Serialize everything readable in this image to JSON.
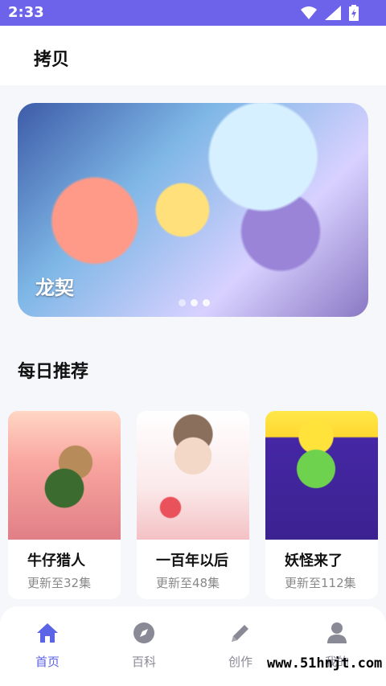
{
  "status": {
    "time": "2:33",
    "icons": [
      "wifi-icon",
      "signal-icon",
      "battery-icon"
    ]
  },
  "header": {
    "title": "拷贝"
  },
  "banner": {
    "title": "龙契",
    "slides_total": 3,
    "active_slide": 2
  },
  "daily": {
    "title": "每日推荐",
    "cards": [
      {
        "title": "牛仔猎人",
        "subtitle": "更新至32集"
      },
      {
        "title": "一百年以后",
        "subtitle": "更新至48集"
      },
      {
        "title": "妖怪来了",
        "subtitle": "更新至112集"
      }
    ]
  },
  "bottom_nav": {
    "items": [
      {
        "label": "首页",
        "icon": "home-icon",
        "active": true
      },
      {
        "label": "百科",
        "icon": "compass-icon",
        "active": false
      },
      {
        "label": "创作",
        "icon": "pencil-icon",
        "active": false
      },
      {
        "label": "我的",
        "icon": "user-icon",
        "active": false
      }
    ],
    "active_color": "#5b63e6",
    "inactive_color": "#8a8a96"
  },
  "watermark": "www.51hnjt.com",
  "colors": {
    "status_bar": "#6d63ea",
    "background": "#f6f7fb"
  }
}
